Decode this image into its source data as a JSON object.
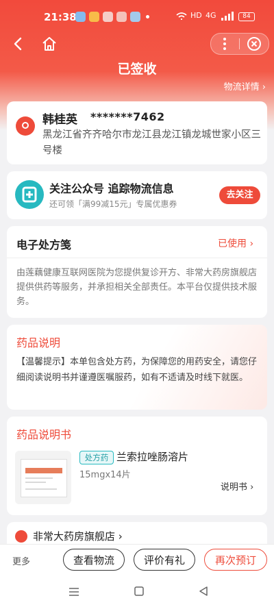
{
  "status_bar": {
    "time": "21:38",
    "battery": "84",
    "hd": "HD",
    "net": "4G"
  },
  "header": {
    "title": "已签收",
    "logistics_link": "物流详情",
    "chevron": "›"
  },
  "address": {
    "name": "韩桂英",
    "phone": "*******7462",
    "text": "黑龙江省齐齐哈尔市龙江县龙江镇龙城世家小区三号楼"
  },
  "follow": {
    "title": "关注公众号 追踪物流信息",
    "subtitle": "还可领「满99减15元」专属优惠券",
    "button": "去关注"
  },
  "prescription": {
    "title": "电子处方笺",
    "status": "已使用",
    "body": "由莲藕健康互联网医院为您提供复诊开方、非常大药房旗舰店提供供药等服务，并承担相关全部责任。本平台仅提供技术服务。"
  },
  "drug_note": {
    "title": "药品说明",
    "body": "【温馨提示】本单包含处方药，为保障您的用药安全，请您仔细阅读说明书并谨遵医嘱服药，如有不适请及时线下就医。"
  },
  "manual": {
    "title": "药品说明书",
    "tag": "处方药",
    "drug_name": "兰索拉唑肠溶片",
    "spec": "15mgx14片",
    "link": "说明书"
  },
  "store": {
    "name": "非常大药房旗舰店"
  },
  "bottom": {
    "more": "更多",
    "btn_logistics": "查看物流",
    "btn_review": "评价有礼",
    "btn_reorder": "再次预订"
  },
  "colors": {
    "brand_red": "#ee4b3a",
    "teal": "#27b9c0"
  }
}
